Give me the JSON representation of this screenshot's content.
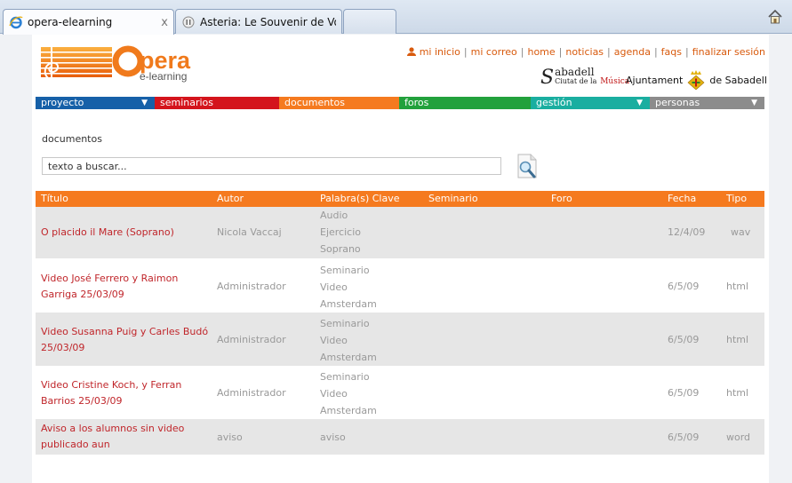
{
  "browser": {
    "tabs": [
      {
        "title": "opera-elearning",
        "close": "x"
      },
      {
        "title": "Asteria: Le Souvenir de Vo..."
      }
    ]
  },
  "header": {
    "logo_word": "pera",
    "logo_sub": "e-learning",
    "top_links": [
      "mi inicio",
      "mi correo",
      "home",
      "noticias",
      "agenda",
      "faqs",
      "finalizar sesión"
    ],
    "sabadell_line1": "abadell",
    "sabadell_line2": "Ciutat de la",
    "sabadell_musica": "Música",
    "ajuntament_left": "Ajuntament",
    "ajuntament_right": "de Sabadell"
  },
  "nav": {
    "items": [
      {
        "label": "proyecto",
        "color": "#1660a8",
        "has_arrow": true
      },
      {
        "label": "seminarios",
        "color": "#d4141c",
        "has_arrow": false
      },
      {
        "label": "documentos",
        "color": "#f57a1f",
        "has_arrow": false
      },
      {
        "label": "foros",
        "color": "#22a13c",
        "has_arrow": false
      },
      {
        "label": "gestión",
        "color": "#1aaea0",
        "has_arrow": true
      },
      {
        "label": "personas",
        "color": "#8c8c8c",
        "has_arrow": true
      }
    ],
    "arrow": "▼"
  },
  "content": {
    "section_title": "documentos",
    "search_placeholder": "texto a buscar..."
  },
  "table": {
    "headers": [
      "Título",
      "Autor",
      "Palabra(s) Clave",
      "Seminario",
      "Foro",
      "Fecha",
      "Tipo"
    ],
    "rows": [
      {
        "title_lines": [
          "O placido il Mare (Soprano)"
        ],
        "author": "Nicola Vaccaj",
        "keywords": [
          "Audio",
          "Ejercicio",
          "Soprano"
        ],
        "date": "12/4/09",
        "type": "wav"
      },
      {
        "title_lines": [
          "Video José Ferrero y Raimon",
          "Garriga 25/03/09"
        ],
        "author": "Administrador",
        "keywords": [
          "Seminario",
          "Video",
          "Amsterdam"
        ],
        "date": "6/5/09",
        "type": "html"
      },
      {
        "title_lines": [
          "Video Susanna Puig y Carles Budó",
          "25/03/09"
        ],
        "author": "Administrador",
        "keywords": [
          "Seminario",
          "Video",
          "Amsterdam"
        ],
        "date": "6/5/09",
        "type": "html"
      },
      {
        "title_lines": [
          "Video Cristine Koch, y Ferran",
          "Barrios 25/03/09"
        ],
        "author": "Administrador",
        "keywords": [
          "Seminario",
          "Video",
          "Amsterdam"
        ],
        "date": "6/5/09",
        "type": "html"
      },
      {
        "title_lines": [
          "Aviso a los alumnos sin video",
          "publicado aun"
        ],
        "author": "aviso",
        "keywords": [
          "aviso"
        ],
        "date": "6/5/09",
        "type": "word"
      }
    ]
  },
  "icons": {
    "tab": "ie-icon",
    "tab2": "page-icon",
    "home": "home-icon",
    "user": "user-icon",
    "search": "search-icon"
  },
  "colors": {
    "accent_orange": "#f57a1f",
    "link_orange": "#d85a0d",
    "title_red": "#c0262b"
  }
}
